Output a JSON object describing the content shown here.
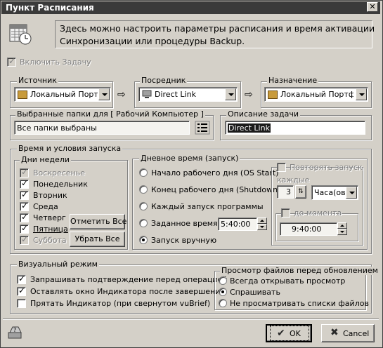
{
  "window": {
    "title": "Пункт Расписания",
    "close_glyph": "✕"
  },
  "info_text": "Здесь можно настроить параметры расписания и время активации\nСинхронизации или процедуры Backup.",
  "enable_task": {
    "label": "Включить Задачу",
    "checked": true
  },
  "source": {
    "legend": "Источник",
    "value": "Локальный Портф"
  },
  "intermediary": {
    "legend": "Посредник",
    "value": "Direct Link"
  },
  "destination": {
    "legend": "Назначение",
    "value": "Локальный Портфе."
  },
  "arrow_glyph": "⇨",
  "folders": {
    "legend": "Выбранные папки для [ Рабочий Компьютер ]",
    "value": "Все папки выбраны"
  },
  "task_desc": {
    "legend": "Описание задачи",
    "value": "Direct Link"
  },
  "launch": {
    "legend": "Время и условия запуска",
    "weekdays": {
      "legend": "Дни недели",
      "days": [
        {
          "label": "Воскресенье",
          "checked": true,
          "disabled": true
        },
        {
          "label": "Понедельник",
          "checked": true,
          "disabled": false
        },
        {
          "label": "Вторник",
          "checked": true,
          "disabled": false
        },
        {
          "label": "Среда",
          "checked": true,
          "disabled": false
        },
        {
          "label": "Четверг",
          "checked": true,
          "disabled": false
        },
        {
          "label": "Пятница",
          "checked": true,
          "disabled": false
        },
        {
          "label": "Суббота",
          "checked": true,
          "disabled": true
        }
      ],
      "select_all": "Отметить Все",
      "clear_all": "Убрать Все"
    },
    "daytime": {
      "legend": "Дневное время (запуск)",
      "options": [
        {
          "label": "Начало рабочего дня (OS Start)",
          "selected": false
        },
        {
          "label": "Конец рабочего дня  (Shutdown)",
          "selected": false
        },
        {
          "label": "Каждый запуск программы",
          "selected": false
        },
        {
          "label": "Заданное время",
          "selected": false
        },
        {
          "label": "Запуск вручную",
          "selected": true
        }
      ],
      "set_time": "5:40:00"
    },
    "repeat": {
      "label": "Повторять запуск",
      "every_label": "каждые",
      "count": "3",
      "unit": "Часа(ов)",
      "until_label": "до момента",
      "until_time": "9:40:00"
    }
  },
  "visual": {
    "legend": "Визуальный режим",
    "options": [
      {
        "label": "Запрашивать подтверждение перед операцией",
        "checked": true
      },
      {
        "label": "Оставлять окно Индикатора после завершения",
        "checked": true
      },
      {
        "label": "Прятать Индикатор (при свернутом vuBrief)",
        "checked": false
      }
    ]
  },
  "preview": {
    "legend": "Просмотр файлов перед обновлением",
    "options": [
      {
        "label": "Всегда открывать просмотр",
        "selected": false
      },
      {
        "label": "Спрашивать",
        "selected": true
      },
      {
        "label": "Не просматривать списки файлов",
        "selected": false
      }
    ]
  },
  "buttons": {
    "ok": "OK",
    "cancel": "Cancel",
    "ok_glyph": "✔",
    "cancel_glyph": "✖"
  }
}
